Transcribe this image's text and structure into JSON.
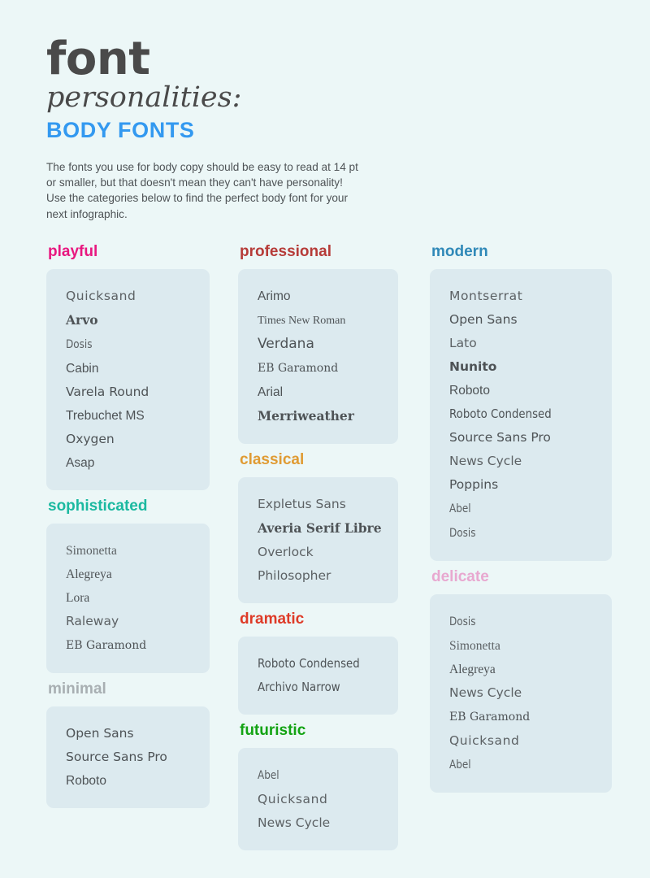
{
  "header": {
    "title_main": "font",
    "title_sub": "personalities:",
    "title_kicker": "BODY FONTS",
    "intro": "The fonts you use for body copy should be easy to read at 14 pt or smaller, but that doesn't mean they can't have personality! Use the categories below to find the perfect body font for your next infographic."
  },
  "colors": {
    "page_background": "#ecf7f7",
    "card_background": "#dceaef",
    "body_text": "#4e5356",
    "heading_dark": "#4a4a4a",
    "kicker_blue": "#3399f0",
    "playful": "#e8177f",
    "sophisticated": "#1bb9a0",
    "minimal": "#a8afb2",
    "professional": "#b63b38",
    "classical": "#e09b33",
    "dramatic": "#de3b28",
    "futuristic": "#13a313",
    "modern": "#3089b8",
    "delicate": "#e8a8d0"
  },
  "columns": [
    {
      "id": "column-left",
      "categories": [
        {
          "id": "playful",
          "label": "playful",
          "color": "#e8177f",
          "fonts": [
            {
              "name": "Quicksand",
              "style": "f-sans-dejavu w-light sz-md wide"
            },
            {
              "name": "Arvo",
              "style": "f-serif-dejavu w-bold sz-md"
            },
            {
              "name": "Dosis",
              "style": "f-sans-dejavu w-light sz-sm narrow"
            },
            {
              "name": "Cabin",
              "style": "f-sans sz-md"
            },
            {
              "name": "Varela Round",
              "style": "f-sans-dejavu sz-md"
            },
            {
              "name": "Trebuchet MS",
              "style": "f-sans sz-md"
            },
            {
              "name": "Oxygen",
              "style": "f-sans-dejavu sz-md"
            },
            {
              "name": "Asap",
              "style": "f-sans sz-md"
            }
          ]
        },
        {
          "id": "sophisticated",
          "label": "sophisticated",
          "color": "#1bb9a0",
          "fonts": [
            {
              "name": "Simonetta",
              "style": "f-serif w-light sz-md"
            },
            {
              "name": "Alegreya",
              "style": "f-serif sz-md"
            },
            {
              "name": "Lora",
              "style": "f-serif sz-md"
            },
            {
              "name": "Raleway",
              "style": "f-sans-dejavu w-light sz-md"
            },
            {
              "name": "EB Garamond",
              "style": "f-serif-dejavu sz-sm"
            }
          ]
        },
        {
          "id": "minimal",
          "label": "minimal",
          "color": "#a8afb2",
          "fonts": [
            {
              "name": "Open Sans",
              "style": "f-sans-dejavu sz-md"
            },
            {
              "name": "Source Sans Pro",
              "style": "f-sans-dejavu sz-md"
            },
            {
              "name": "Roboto",
              "style": "f-sans sz-md"
            }
          ]
        }
      ]
    },
    {
      "id": "column-middle",
      "categories": [
        {
          "id": "professional",
          "label": "professional",
          "color": "#b63b38",
          "fonts": [
            {
              "name": "Arimo",
              "style": "f-sans sz-md"
            },
            {
              "name": "Times New Roman",
              "style": "f-serif sz-sm"
            },
            {
              "name": "Verdana",
              "style": "f-sans-dejavu sz-lg"
            },
            {
              "name": "EB Garamond",
              "style": "f-serif-dejavu sz-sm"
            },
            {
              "name": "Arial",
              "style": "f-sans sz-md"
            },
            {
              "name": "Merriweather",
              "style": "f-serif-dejavu w-bold sz-md"
            }
          ]
        },
        {
          "id": "classical",
          "label": "classical",
          "color": "#e09b33",
          "fonts": [
            {
              "name": "Expletus Sans",
              "style": "f-sans-dejavu w-light sz-md"
            },
            {
              "name": "Averia Serif Libre",
              "style": "f-serif-dejavu w-bold sz-md"
            },
            {
              "name": "Overlock",
              "style": "f-sans-dejavu w-light sz-md"
            },
            {
              "name": "Philosopher",
              "style": "f-sans-dejavu w-light sz-md"
            }
          ]
        },
        {
          "id": "dramatic",
          "label": "dramatic",
          "color": "#de3b28",
          "fonts": [
            {
              "name": "Roboto Condensed",
              "style": "f-sans-dejavu sz-md narrow"
            },
            {
              "name": "Archivo Narrow",
              "style": "f-sans-dejavu sz-md narrow"
            }
          ]
        },
        {
          "id": "futuristic",
          "label": "futuristic",
          "color": "#13a313",
          "fonts": [
            {
              "name": "Abel",
              "style": "f-sans-dejavu w-light sz-sm narrow"
            },
            {
              "name": "Quicksand",
              "style": "f-sans-dejavu w-light sz-md wide"
            },
            {
              "name": "News Cycle",
              "style": "f-sans-dejavu w-light sz-md"
            }
          ]
        }
      ]
    },
    {
      "id": "column-right",
      "categories": [
        {
          "id": "modern",
          "label": "modern",
          "color": "#3089b8",
          "fonts": [
            {
              "name": "Montserrat",
              "style": "f-sans-dejavu w-light sz-md wide"
            },
            {
              "name": "Open Sans",
              "style": "f-sans-dejavu sz-md"
            },
            {
              "name": "Lato",
              "style": "f-sans-dejavu w-light sz-md"
            },
            {
              "name": "Nunito",
              "style": "f-sans-dejavu w-bold sz-md"
            },
            {
              "name": "Roboto",
              "style": "f-sans sz-md"
            },
            {
              "name": "Roboto Condensed",
              "style": "f-sans-dejavu sz-md narrow"
            },
            {
              "name": "Source Sans Pro",
              "style": "f-sans-dejavu sz-md"
            },
            {
              "name": "News Cycle",
              "style": "f-sans-dejavu w-light sz-md"
            },
            {
              "name": "Poppins",
              "style": "f-sans-dejavu sz-md"
            },
            {
              "name": "Abel",
              "style": "f-sans-dejavu w-light sz-sm narrow"
            },
            {
              "name": "Dosis",
              "style": "f-sans-dejavu w-light sz-sm narrow"
            }
          ]
        },
        {
          "id": "delicate",
          "label": "delicate",
          "color": "#e8a8d0",
          "fonts": [
            {
              "name": "Dosis",
              "style": "f-sans-dejavu w-light sz-sm narrow"
            },
            {
              "name": "Simonetta",
              "style": "f-serif w-light sz-md"
            },
            {
              "name": "Alegreya",
              "style": "f-serif sz-md"
            },
            {
              "name": "News Cycle",
              "style": "f-sans-dejavu w-light sz-md"
            },
            {
              "name": "EB Garamond",
              "style": "f-serif-dejavu sz-sm"
            },
            {
              "name": "Quicksand",
              "style": "f-sans-dejavu w-light sz-md wide"
            },
            {
              "name": "Abel",
              "style": "f-sans-dejavu w-light sz-sm narrow"
            }
          ]
        }
      ]
    }
  ]
}
